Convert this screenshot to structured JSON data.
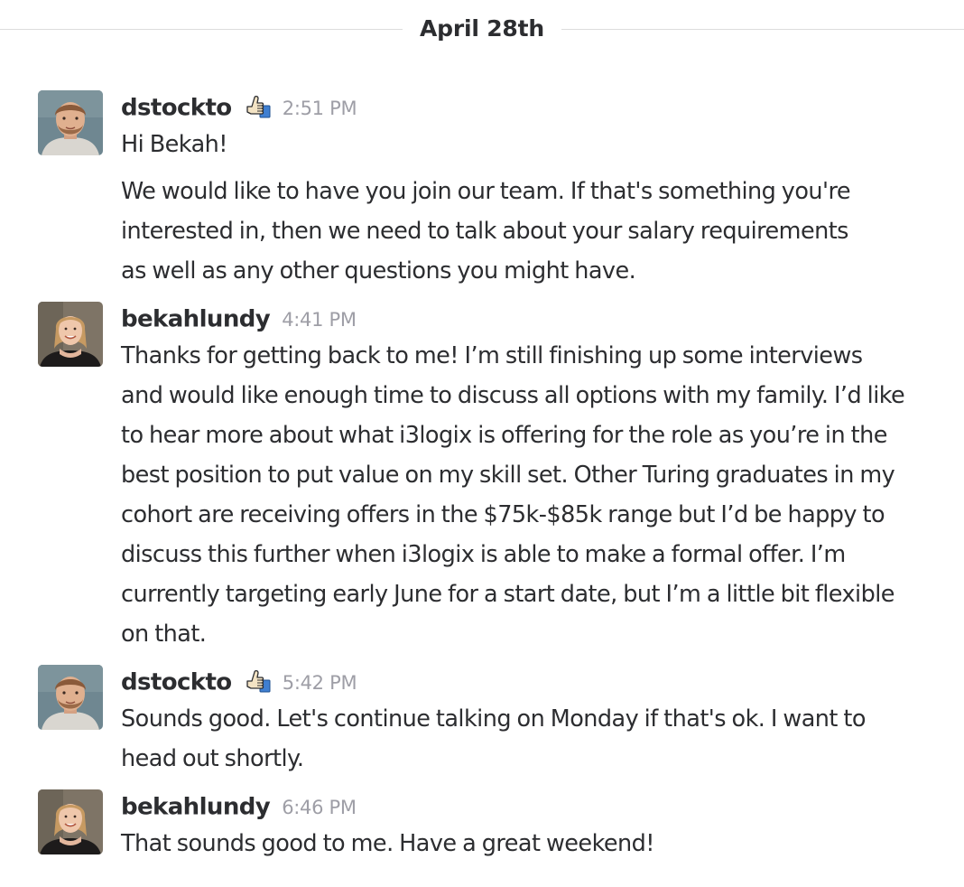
{
  "day_divider": {
    "label": "April 28th"
  },
  "messages": [
    {
      "sender": "dstockto",
      "status_icon": "thumbs-up-icon",
      "time": "2:51 PM",
      "avatar": "avatar-dstockto",
      "paragraphs": [
        "Hi Bekah!",
        "We would like to have you join our team. If that's something you're interested in, then we need to talk about your salary requirements as well as any other questions you might have."
      ]
    },
    {
      "sender": "bekahlundy",
      "time": "4:41 PM",
      "avatar": "avatar-bekahlundy",
      "paragraphs": [
        "Thanks for getting back to me! I’m still finishing up some interviews and would like enough time to discuss all options with my family. I’d like to hear more about what i3logix is offering for the role as you’re in the best position to put value on my skill set. Other Turing graduates in my cohort are receiving offers in the $75k-$85k range but I’d be happy to discuss this further when i3logix is able to make a formal offer. I’m currently targeting early June for a start date, but I’m a little bit flexible on that."
      ]
    },
    {
      "sender": "dstockto",
      "status_icon": "thumbs-up-icon",
      "time": "5:42 PM",
      "avatar": "avatar-dstockto",
      "paragraphs": [
        "Sounds good. Let's continue talking on Monday if that's ok. I want to head out shortly."
      ]
    },
    {
      "sender": "bekahlundy",
      "time": "6:46 PM",
      "avatar": "avatar-bekahlundy",
      "paragraphs": [
        "That sounds good to me. Have a great weekend!"
      ]
    }
  ],
  "colors": {
    "text": "#2c2d30",
    "timestamp": "#9e9ea6",
    "divider": "#dcdcdc",
    "background": "#ffffff"
  }
}
